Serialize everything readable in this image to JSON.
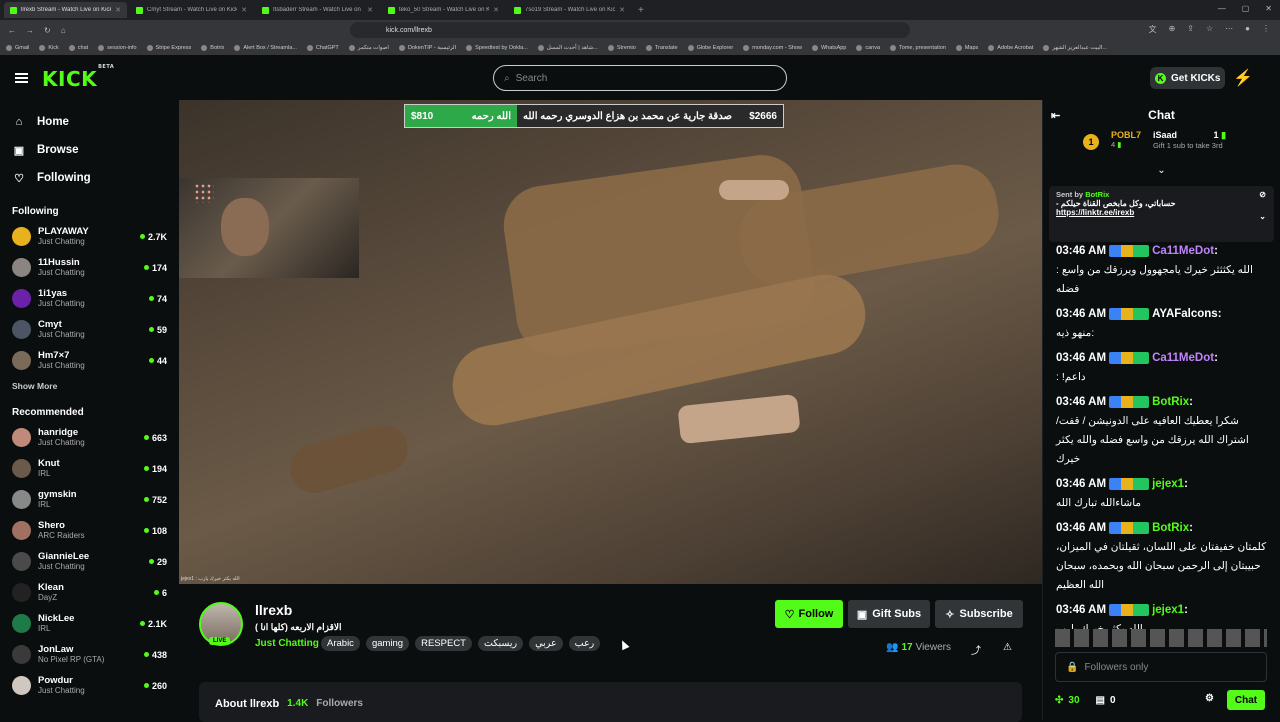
{
  "browser": {
    "tabs": [
      {
        "label": "llrexb Stream - Watch Live on Kick",
        "active": true
      },
      {
        "label": "Cmyt Stream - Watch Live on Kick",
        "active": false
      },
      {
        "label": "Itsbaderr Stream - Watch Live on Kick",
        "active": false
      },
      {
        "label": "teko_50 Stream - Watch Live on Kick",
        "active": false
      },
      {
        "label": "7so19 Stream - Watch Live on Kick",
        "active": false
      }
    ],
    "url": "kick.com/llrexb",
    "bookmarks": [
      "Gmail",
      "Kick",
      "chat",
      "session-info",
      "Stripe Express",
      "Botrix",
      "Alert Box / Streamla...",
      "ChatGPT",
      "اصوات متكمر",
      "DokenTIP - الرئيسية",
      "Speedtest by Ookla...",
      "شاهد | أحدث المسل...",
      "Stremio",
      "Translate",
      "Globe Explorer",
      "monday.com - Show",
      "WhatsApp",
      "canva",
      "Tome, presentation",
      "Maps",
      "Adobe Acrobat",
      "البيت عبدالعزيز الشهر..."
    ]
  },
  "header": {
    "logo": "KICK",
    "logo_sup": "BETA",
    "search_placeholder": "Search",
    "get_kicks": "Get KICKs"
  },
  "sidebar": {
    "nav": [
      {
        "label": "Home",
        "icon": "home-icon"
      },
      {
        "label": "Browse",
        "icon": "browse-icon"
      },
      {
        "label": "Following",
        "icon": "heart-icon"
      }
    ],
    "following_title": "Following",
    "following": [
      {
        "name": "PLAYAWAY",
        "category": "Just Chatting",
        "viewers": "2.7K",
        "color": "#e8b21d"
      },
      {
        "name": "11Hussin",
        "category": "Just Chatting",
        "viewers": "174",
        "color": "#8a8580"
      },
      {
        "name": "1i1yas",
        "category": "Just Chatting",
        "viewers": "74",
        "color": "#6b21a8"
      },
      {
        "name": "Cmyt",
        "category": "Just Chatting",
        "viewers": "59",
        "color": "#4b5563"
      },
      {
        "name": "Hm7×7",
        "category": "Just Chatting",
        "viewers": "44",
        "color": "#7a6a5a"
      }
    ],
    "show_more": "Show More",
    "recommended_title": "Recommended",
    "recommended": [
      {
        "name": "hanridge",
        "category": "Just Chatting",
        "viewers": "663",
        "color": "#c08a7a"
      },
      {
        "name": "Knut",
        "category": "IRL",
        "viewers": "194",
        "color": "#6b5a4a"
      },
      {
        "name": "gymskin",
        "category": "IRL",
        "viewers": "752",
        "color": "#888888"
      },
      {
        "name": "Shero",
        "category": "ARC Raiders",
        "viewers": "108",
        "color": "#a07060"
      },
      {
        "name": "GiannieLee",
        "category": "Just Chatting",
        "viewers": "29",
        "color": "#4a4a4a"
      },
      {
        "name": "Klean",
        "category": "DayZ",
        "viewers": "6",
        "color": "#222222"
      },
      {
        "name": "NickLee",
        "category": "IRL",
        "viewers": "2.1K",
        "color": "#1f7a4a"
      },
      {
        "name": "JonLaw",
        "category": "No Pixel RP (GTA)",
        "viewers": "438",
        "color": "#3a3a3a"
      },
      {
        "name": "Powdur",
        "category": "Just Chatting",
        "viewers": "260",
        "color": "#d0c8c0"
      }
    ]
  },
  "video": {
    "banner_left_amount": "$810",
    "banner_left_text": "الله رحمه",
    "banner_right_text": "صدقة جارية عن محمد بن هزاع الدوسري رحمه الله",
    "banner_right_amount": "$2666",
    "caption": "jejex1 : الله يكثر خيرك يارب"
  },
  "stream": {
    "live_label": "LIVE",
    "name": "llrexb",
    "title": "الاقزام الاربعه (كلها انا )",
    "category": "Just Chatting",
    "tags": [
      "Arabic",
      "gaming",
      "RESPECT",
      "ريسبكت",
      "عربي",
      "رعب"
    ],
    "follow": "Follow",
    "gift_subs": "Gift Subs",
    "subscribe": "Subscribe",
    "viewers": "17",
    "viewers_label": "Viewers",
    "about_title": "About llrexb",
    "followers_count": "1.4K",
    "followers_label": "Followers"
  },
  "chat": {
    "title": "Chat",
    "leader1": {
      "rank": "1",
      "name": "POBL7",
      "count": "4"
    },
    "leader2": {
      "name": "iSaad",
      "count": "1",
      "hint": "Gift 1 sub to take 3rd"
    },
    "pinned": {
      "sent_by": "Sent by",
      "user": "BotRix",
      "text": "حساباتي، وكل مابخص القناة حيلكم -",
      "link": "https://linktr.ee/irexb"
    },
    "messages": [
      {
        "time": "03:46 AM",
        "user": "Ca11MeDot",
        "color": "#c084fc",
        "text": "الله يكثثثر خيرك يامجهوول ويرزقك من واسع : فضله"
      },
      {
        "time": "03:46 AM",
        "user": "AYAFalcons",
        "color": "#ffffff",
        "text": ":منهو ذيه"
      },
      {
        "time": "03:46 AM",
        "user": "Ca11MeDot",
        "color": "#c084fc",
        "text": "داعم! :"
      },
      {
        "time": "03:46 AM",
        "user": "BotRix",
        "color": "#53fc18",
        "text": "شكرا يعطيك العافيه على الدونيشن / قفت/ اشتراك الله يرزقك من واسع فضله والله يكثر خيرك"
      },
      {
        "time": "03:46 AM",
        "user": "jejex1",
        "color": "#53fc18",
        "text": "ماشاءالله تبارك الله"
      },
      {
        "time": "03:46 AM",
        "user": "BotRix",
        "color": "#53fc18",
        "text": "كلمتان خفيفتان على اللسان، ثقيلتان في الميزان، حبيبتان إلى الرحمن سبحان الله وبحمده، سبحان الله العظيم"
      },
      {
        "time": "03:46 AM",
        "user": "jejex1",
        "color": "#53fc18",
        "text": "الله يكثر خيرك يارب"
      }
    ],
    "input_placeholder": "Followers only",
    "kicks": "30",
    "gifts": "0",
    "send": "Chat"
  }
}
